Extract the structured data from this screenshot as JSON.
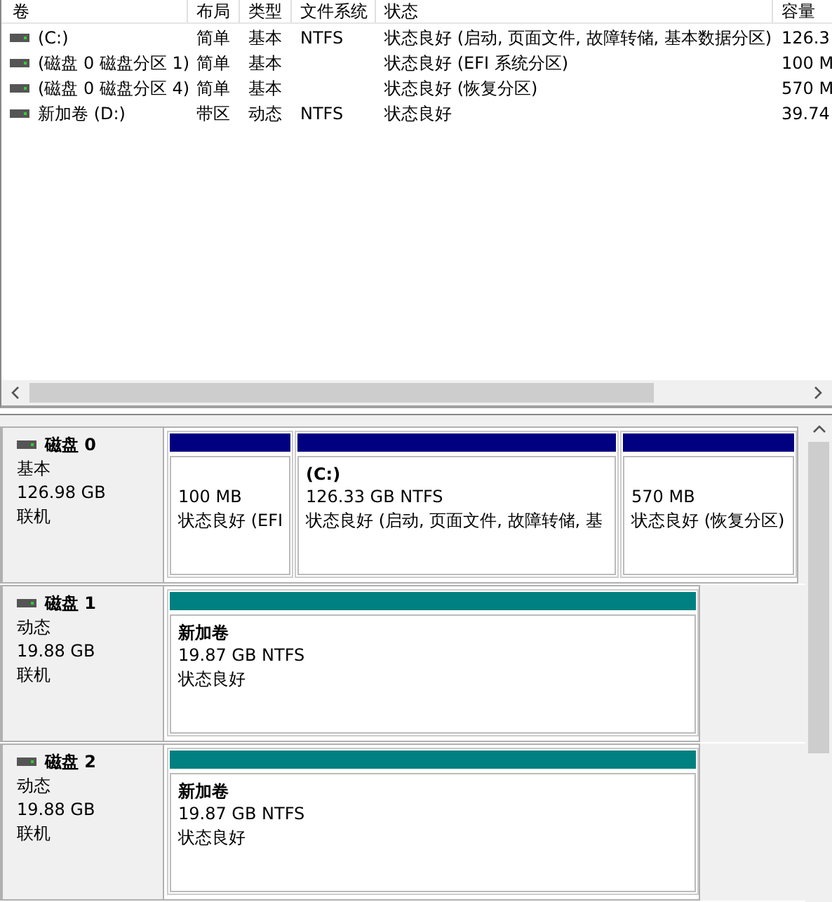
{
  "volume_table": {
    "columns": [
      "卷",
      "布局",
      "类型",
      "文件系统",
      "状态",
      "容量"
    ],
    "rows": [
      {
        "cells": [
          "(C:)",
          "简单",
          "基本",
          "NTFS",
          "状态良好 (启动, 页面文件, 故障转储, 基本数据分区)",
          "126.3"
        ]
      },
      {
        "cells": [
          "(磁盘 0 磁盘分区 1)",
          "简单",
          "基本",
          "",
          "状态良好 (EFI 系统分区)",
          "100 M"
        ]
      },
      {
        "cells": [
          "(磁盘 0 磁盘分区 4)",
          "简单",
          "基本",
          "",
          "状态良好 (恢复分区)",
          "570 M"
        ]
      },
      {
        "cells": [
          "新加卷 (D:)",
          "带区",
          "动态",
          "NTFS",
          "状态良好",
          "39.74"
        ]
      }
    ]
  },
  "disks": [
    {
      "name": "磁盘 0",
      "type": "基本",
      "size": "126.98 GB",
      "status": "联机",
      "partitions": [
        {
          "color": "#000080",
          "size": "100 MB",
          "status": "状态良好 (EFI"
        },
        {
          "color": "#000080",
          "name": "(C:)",
          "size": "126.33 GB NTFS",
          "status": "状态良好 (启动, 页面文件, 故障转储, 基"
        },
        {
          "color": "#000080",
          "size": "570 MB",
          "status": "状态良好 (恢复分区)"
        }
      ]
    },
    {
      "name": "磁盘 1",
      "type": "动态",
      "size": "19.88 GB",
      "status": "联机",
      "partitions": [
        {
          "color": "#008080",
          "name": "新加卷",
          "size": "19.87 GB NTFS",
          "status": "状态良好"
        }
      ]
    },
    {
      "name": "磁盘 2",
      "type": "动态",
      "size": "19.88 GB",
      "status": "联机",
      "partitions": [
        {
          "color": "#008080",
          "name": "新加卷",
          "size": "19.87 GB NTFS",
          "status": "状态良好"
        }
      ]
    }
  ]
}
